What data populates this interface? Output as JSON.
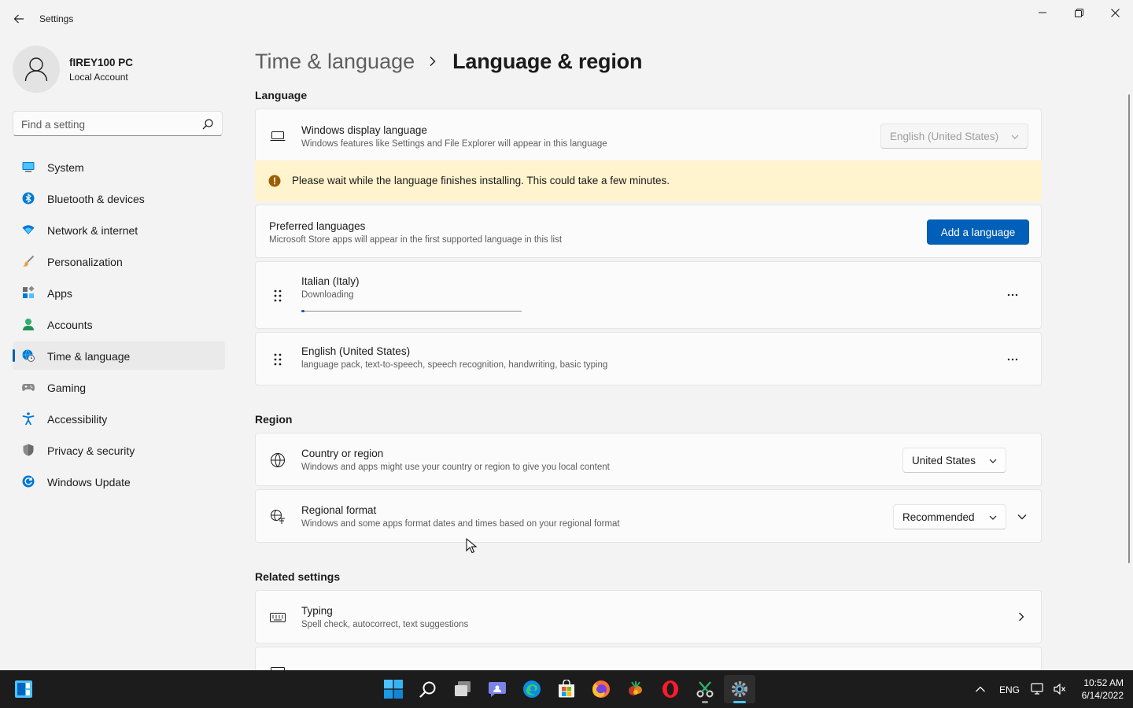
{
  "window": {
    "title": "Settings"
  },
  "profile": {
    "name": "fIREY100 PC",
    "account_type": "Local Account"
  },
  "search": {
    "placeholder": "Find a setting"
  },
  "sidebar": {
    "items": [
      {
        "label": "System",
        "icon": "system-icon",
        "active": false
      },
      {
        "label": "Bluetooth & devices",
        "icon": "bluetooth-icon",
        "active": false
      },
      {
        "label": "Network & internet",
        "icon": "wifi-icon",
        "active": false
      },
      {
        "label": "Personalization",
        "icon": "brush-icon",
        "active": false
      },
      {
        "label": "Apps",
        "icon": "apps-icon",
        "active": false
      },
      {
        "label": "Accounts",
        "icon": "accounts-icon",
        "active": false
      },
      {
        "label": "Time & language",
        "icon": "globe-clock-icon",
        "active": true
      },
      {
        "label": "Gaming",
        "icon": "gamepad-icon",
        "active": false
      },
      {
        "label": "Accessibility",
        "icon": "accessibility-icon",
        "active": false
      },
      {
        "label": "Privacy & security",
        "icon": "shield-icon",
        "active": false
      },
      {
        "label": "Windows Update",
        "icon": "update-icon",
        "active": false
      }
    ]
  },
  "breadcrumb": {
    "parent": "Time & language",
    "current": "Language & region"
  },
  "language_section": {
    "title": "Language",
    "display_language": {
      "title": "Windows display language",
      "subtitle": "Windows features like Settings and File Explorer will appear in this language",
      "value": "English (United States)"
    },
    "warning": "Please wait while the language finishes installing. This could take a few minutes.",
    "preferred": {
      "title": "Preferred languages",
      "subtitle": "Microsoft Store apps will appear in the first supported language in this list",
      "button_label": "Add a language"
    },
    "languages": [
      {
        "name": "Italian (Italy)",
        "status": "Downloading",
        "progress": 0.01
      },
      {
        "name": "English (United States)",
        "status": "language pack, text-to-speech, speech recognition, handwriting, basic typing"
      }
    ]
  },
  "region_section": {
    "title": "Region",
    "country": {
      "title": "Country or region",
      "subtitle": "Windows and apps might use your country or region to give you local content",
      "value": "United States"
    },
    "format": {
      "title": "Regional format",
      "subtitle": "Windows and some apps format dates and times based on your regional format",
      "value": "Recommended"
    }
  },
  "related_section": {
    "title": "Related settings",
    "typing": {
      "title": "Typing",
      "subtitle": "Spell check, autocorrect, text suggestions"
    }
  },
  "taskbar": {
    "apps": [
      "start",
      "search",
      "task-view",
      "teams-chat",
      "edge",
      "store",
      "firefox",
      "game-app",
      "opera",
      "snipping-app",
      "settings"
    ],
    "tray_language": "ENG",
    "time": "10:52 AM",
    "date": "6/14/2022"
  },
  "colors": {
    "accent": "#005fb8",
    "warning_bg": "#fff4ce",
    "warning_icon": "#9d5d00"
  }
}
